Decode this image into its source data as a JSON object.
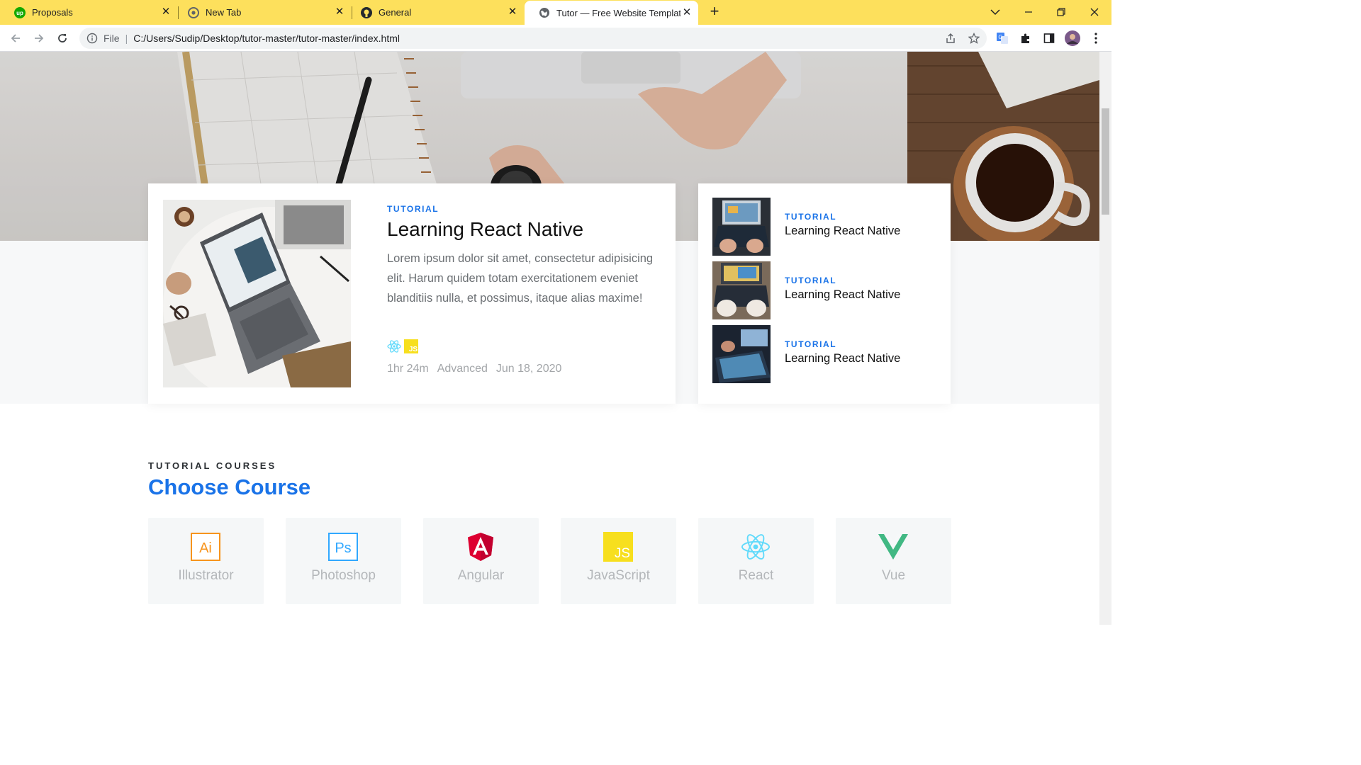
{
  "browser": {
    "tabs": [
      {
        "label": "Proposals",
        "icon": "upwork-icon"
      },
      {
        "label": "New Tab",
        "icon": "chrome-icon"
      },
      {
        "label": "General",
        "icon": "github-icon"
      },
      {
        "label": "Tutor — Free Website Template",
        "icon": "globe-icon"
      }
    ],
    "address": {
      "scheme": "File",
      "url": "C:/Users/Sudip/Desktop/tutor-master/tutor-master/index.html"
    }
  },
  "featured": {
    "eyebrow": "TUTORIAL",
    "title": "Learning React Native",
    "description": "Lorem ipsum dolor sit amet, consectetur adipisicing elit. Harum quidem totam exercitationem eveniet blanditiis nulla, et possimus, itaque alias maxime!",
    "tech_icons": [
      "react-icon",
      "javascript-icon"
    ],
    "meta": {
      "duration": "1hr 24m",
      "level": "Advanced",
      "date": "Jun 18, 2020"
    }
  },
  "side_posts": [
    {
      "eyebrow": "TUTORIAL",
      "title": "Learning React Native"
    },
    {
      "eyebrow": "TUTORIAL",
      "title": "Learning React Native"
    },
    {
      "eyebrow": "TUTORIAL",
      "title": "Learning React Native"
    }
  ],
  "courses_section": {
    "eyebrow": "TUTORIAL COURSES",
    "title": "Choose Course",
    "courses": [
      {
        "label": "Illustrator",
        "icon": "illustrator-icon"
      },
      {
        "label": "Photoshop",
        "icon": "photoshop-icon"
      },
      {
        "label": "Angular",
        "icon": "angular-icon"
      },
      {
        "label": "JavaScript",
        "icon": "javascript-icon"
      },
      {
        "label": "React",
        "icon": "react-icon"
      },
      {
        "label": "Vue",
        "icon": "vue-icon"
      }
    ]
  },
  "colors": {
    "accent": "#1a73e8",
    "tabbar": "#fde05c"
  }
}
